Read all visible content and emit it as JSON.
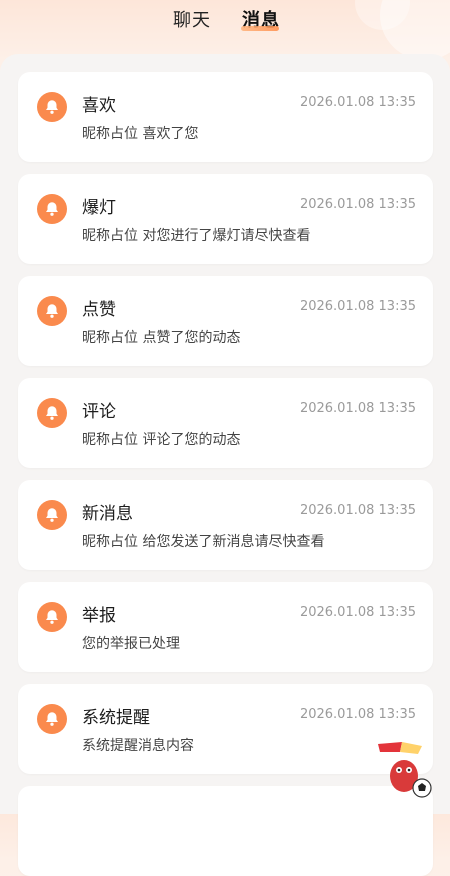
{
  "tabs": [
    {
      "label": "聊天",
      "active": false
    },
    {
      "label": "消息",
      "active": true
    }
  ],
  "accent_color": "#fa8a4d",
  "icon": "bell-icon",
  "messages": [
    {
      "title": "喜欢",
      "time": "2026.01.08 13:35",
      "desc": "昵称占位 喜欢了您"
    },
    {
      "title": "爆灯",
      "time": "2026.01.08 13:35",
      "desc": "昵称占位 对您进行了爆灯请尽快查看"
    },
    {
      "title": "点赞",
      "time": "2026.01.08 13:35",
      "desc": "昵称占位 点赞了您的动态"
    },
    {
      "title": "评论",
      "time": "2026.01.08 13:35",
      "desc": "昵称占位 评论了您的动态"
    },
    {
      "title": "新消息",
      "time": "2026.01.08 13:35",
      "desc": "昵称占位 给您发送了新消息请尽快查看"
    },
    {
      "title": "举报",
      "time": "2026.01.08 13:35",
      "desc": "您的举报已处理"
    },
    {
      "title": "系统提醒",
      "time": "2026.01.08 13:35",
      "desc": "系统提醒消息内容"
    }
  ]
}
